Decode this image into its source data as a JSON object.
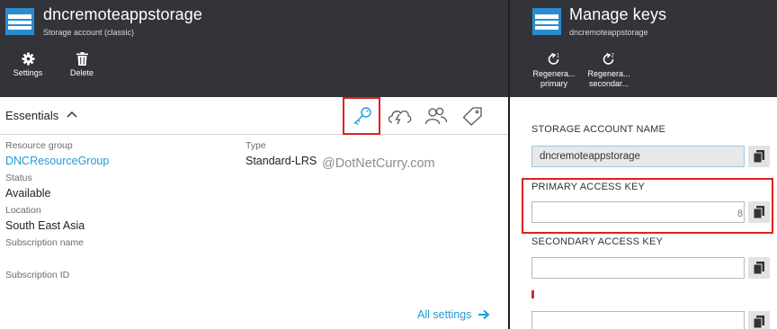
{
  "left_blade": {
    "title": "dncremoteappstorage",
    "subtitle": "Storage account (classic)",
    "icon": "storage-account-icon",
    "commands": [
      {
        "label": "Settings",
        "icon": "gear-icon"
      },
      {
        "label": "Delete",
        "icon": "trash-icon"
      }
    ],
    "essentials": {
      "label": "Essentials",
      "tools": [
        "key-icon",
        "cloud-lightning-icon",
        "users-icon",
        "tag-icon"
      ],
      "resource_group_label": "Resource group",
      "resource_group_value": "DNCResourceGroup",
      "status_label": "Status",
      "status_value": "Available",
      "location_label": "Location",
      "location_value": "South East Asia",
      "subscription_name_label": "Subscription name",
      "subscription_id_label": "Subscription ID",
      "type_label": "Type",
      "type_value": "Standard-LRS"
    },
    "watermark": "@DotNetCurry.com",
    "all_settings": "All settings"
  },
  "right_blade": {
    "title": "Manage keys",
    "subtitle": "dncremoteappstorage",
    "commands": [
      {
        "label_line1": "Regenera...",
        "label_line2": "primary",
        "icon": "regenerate-1-icon"
      },
      {
        "label_line1": "Regenera...",
        "label_line2": "secondar...",
        "icon": "regenerate-2-icon"
      }
    ],
    "storage_account_name_label": "STORAGE ACCOUNT NAME",
    "storage_account_name_value": "dncremoteappstorage",
    "primary_key_label": "PRIMARY ACCESS KEY",
    "primary_key_value": "",
    "primary_key_trailing_char": "8",
    "secondary_key_label": "SECONDARY ACCESS KEY",
    "secondary_key_value": "",
    "hidden_field_value": ""
  },
  "colors": {
    "header_bg": "#32343a",
    "link": "#1f9bd8",
    "highlight": "#e0201f",
    "storage_icon": "#2a8bd0"
  }
}
